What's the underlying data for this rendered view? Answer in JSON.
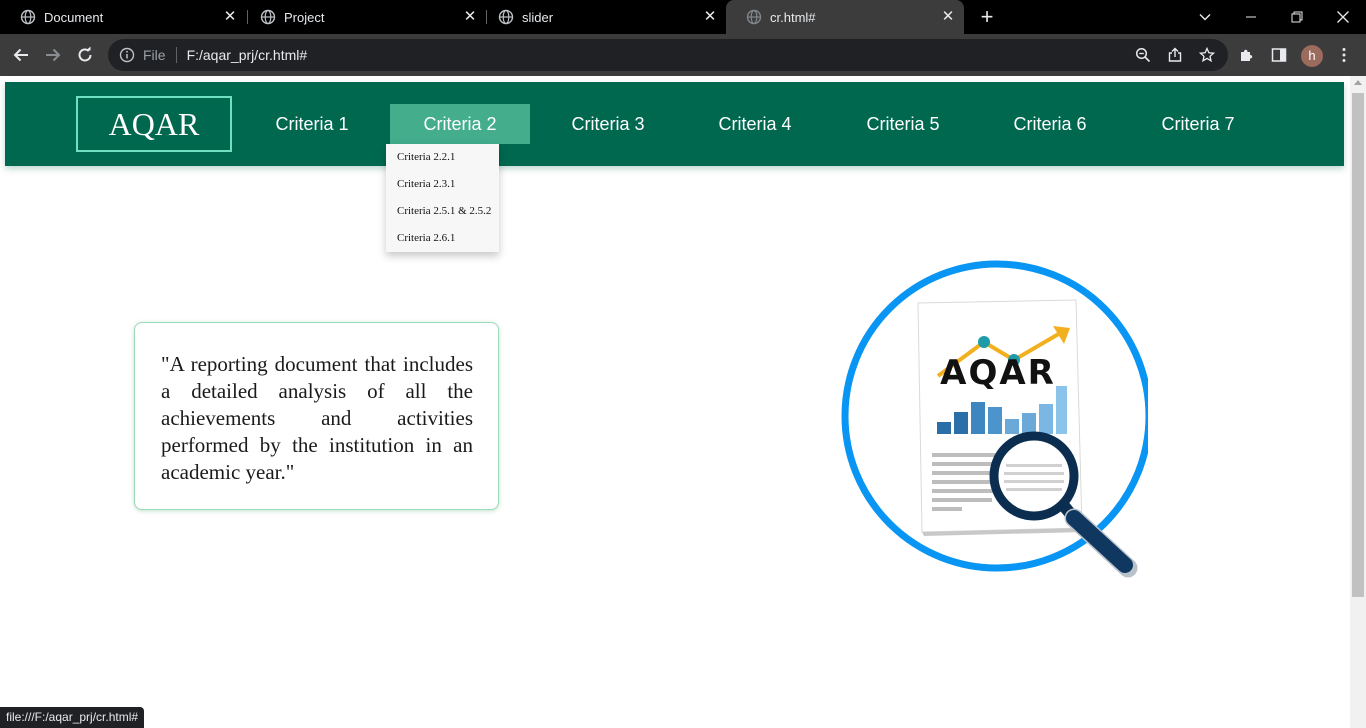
{
  "browser": {
    "tabs": [
      {
        "title": "Document"
      },
      {
        "title": "Project"
      },
      {
        "title": "slider"
      },
      {
        "title": "cr.html#"
      }
    ],
    "address": {
      "scheme_label": "File",
      "url": "F:/aqar_prj/cr.html#"
    },
    "profile_initial": "h",
    "status_url": "file:///F:/aqar_prj/cr.html#"
  },
  "site": {
    "logo": "AQAR",
    "menu": [
      {
        "label": "Criteria 1"
      },
      {
        "label": "Criteria 2",
        "active": true
      },
      {
        "label": "Criteria 3"
      },
      {
        "label": "Criteria 4"
      },
      {
        "label": "Criteria 5"
      },
      {
        "label": "Criteria 6"
      },
      {
        "label": "Criteria 7"
      }
    ],
    "dropdown": [
      {
        "label": "Criteria 2.2.1"
      },
      {
        "label": "Criteria 2.3.1"
      },
      {
        "label": "Criteria 2.5.1 & 2.5.2"
      },
      {
        "label": "Criteria 2.6.1"
      }
    ],
    "quote": "\"A reporting document that includes a detailed analysis of all the achievements and activities performed by the institution in an academic year.\"",
    "illustration_text": "AQAR"
  },
  "colors": {
    "navbar": "#00684f",
    "active_menu": "#43ad8c",
    "logo_border": "#6fe0c2",
    "ring": "#0895f3",
    "magnifier": "#0b2d4f"
  }
}
